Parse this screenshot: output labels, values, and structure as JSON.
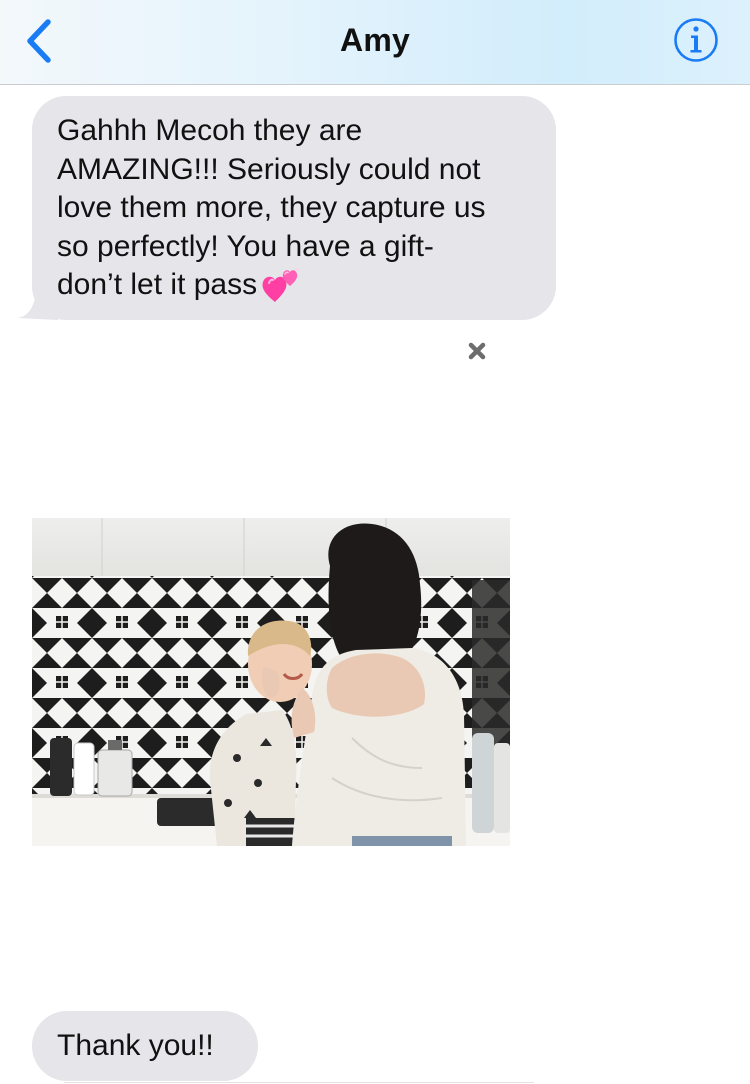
{
  "header": {
    "title": "Amy",
    "back_icon": "chevron-left-icon",
    "info_icon": "info-icon",
    "accent_color": "#1a7cf5"
  },
  "messages": [
    {
      "direction": "incoming",
      "lines": [
        "Gahhh Mecoh they are",
        "AMAZING!!! Seriously could not",
        "love them more, they capture us",
        "so perfectly! You have a gift-",
        "don’t let it pass"
      ],
      "emoji": "two-hearts-icon"
    },
    {
      "direction": "incoming",
      "type": "image",
      "description_icon": "photo-attachment"
    },
    {
      "direction": "incoming",
      "text": "Thank you!!"
    }
  ],
  "colors": {
    "bubble_gray": "#e5e5ea",
    "header_tint": "#d2edfb"
  }
}
